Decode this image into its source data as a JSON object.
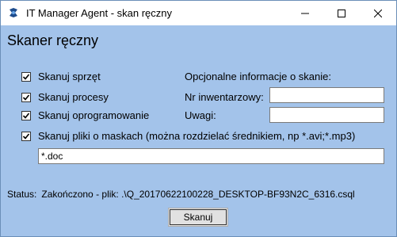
{
  "window": {
    "title": "IT Manager Agent - skan ręczny"
  },
  "heading": "Skaner ręczny",
  "options": {
    "scan_hardware": {
      "label": "Skanuj sprzęt",
      "checked": true
    },
    "scan_processes": {
      "label": "Skanuj procesy",
      "checked": true
    },
    "scan_software": {
      "label": "Skanuj oprogramowanie",
      "checked": true
    },
    "scan_files": {
      "label": "Skanuj pliki o maskach (można rozdzielać średnikiem, np *.avi;*.mp3)",
      "checked": true
    }
  },
  "file_mask": {
    "value": "*.doc"
  },
  "optional_info": {
    "title": "Opcjonalne informacje o skanie:",
    "inventory_label": "Nr inwentarzowy:",
    "inventory_value": "",
    "notes_label": "Uwagi:",
    "notes_value": ""
  },
  "status": {
    "label": "Status:",
    "value": "Zakończono - plik: .\\Q_20170622100228_DESKTOP-BF93N2C_6316.csql"
  },
  "scan_button": {
    "label": "Skanuj"
  },
  "icons": {
    "app": "app-logo-icon",
    "minimize": "minimize-icon",
    "maximize": "maximize-icon",
    "close": "close-icon",
    "check": "checkmark-icon"
  },
  "colors": {
    "background": "#a3c3ea",
    "titlebar": "#ffffff",
    "button": "#e1e1e1"
  }
}
